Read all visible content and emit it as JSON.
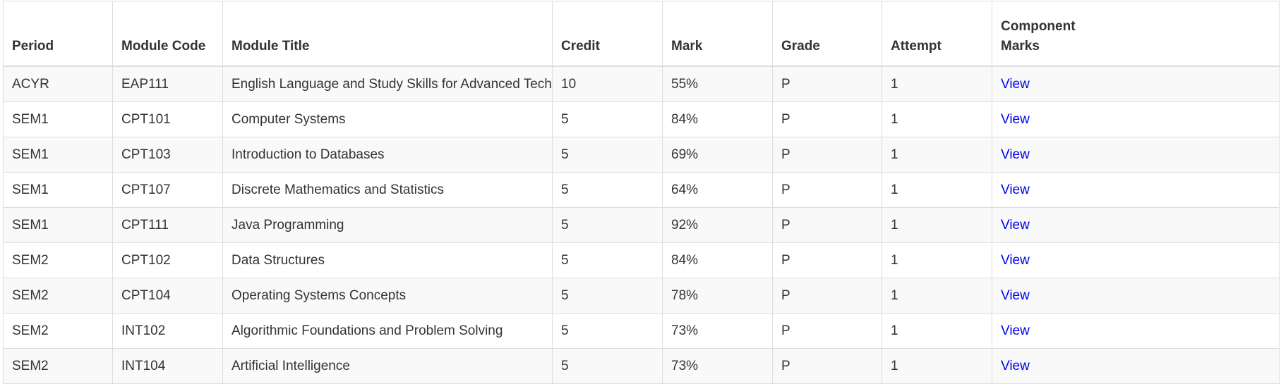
{
  "table": {
    "headers": {
      "period": "Period",
      "module_code": "Module Code",
      "module_title": "Module Title",
      "credit": "Credit",
      "mark": "Mark",
      "grade": "Grade",
      "attempt": "Attempt",
      "component_marks": "Component Marks"
    },
    "rows": [
      {
        "period": "ACYR",
        "module_code": "EAP111",
        "module_title": "English Language and Study Skills for Advanced Technology",
        "credit": "10",
        "mark": "55%",
        "grade": "P",
        "attempt": "1",
        "component_marks": "View"
      },
      {
        "period": "SEM1",
        "module_code": "CPT101",
        "module_title": "Computer Systems",
        "credit": "5",
        "mark": "84%",
        "grade": "P",
        "attempt": "1",
        "component_marks": "View"
      },
      {
        "period": "SEM1",
        "module_code": "CPT103",
        "module_title": "Introduction to Databases",
        "credit": "5",
        "mark": "69%",
        "grade": "P",
        "attempt": "1",
        "component_marks": "View"
      },
      {
        "period": "SEM1",
        "module_code": "CPT107",
        "module_title": "Discrete Mathematics and Statistics",
        "credit": "5",
        "mark": "64%",
        "grade": "P",
        "attempt": "1",
        "component_marks": "View"
      },
      {
        "period": "SEM1",
        "module_code": "CPT111",
        "module_title": "Java Programming",
        "credit": "5",
        "mark": "92%",
        "grade": "P",
        "attempt": "1",
        "component_marks": "View"
      },
      {
        "period": "SEM2",
        "module_code": "CPT102",
        "module_title": "Data Structures",
        "credit": "5",
        "mark": "84%",
        "grade": "P",
        "attempt": "1",
        "component_marks": "View"
      },
      {
        "period": "SEM2",
        "module_code": "CPT104",
        "module_title": "Operating Systems Concepts",
        "credit": "5",
        "mark": "78%",
        "grade": "P",
        "attempt": "1",
        "component_marks": "View"
      },
      {
        "period": "SEM2",
        "module_code": "INT102",
        "module_title": "Algorithmic Foundations and Problem Solving",
        "credit": "5",
        "mark": "73%",
        "grade": "P",
        "attempt": "1",
        "component_marks": "View"
      },
      {
        "period": "SEM2",
        "module_code": "INT104",
        "module_title": "Artificial Intelligence",
        "credit": "5",
        "mark": "73%",
        "grade": "P",
        "attempt": "1",
        "component_marks": "View"
      }
    ]
  },
  "colors": {
    "link": "#0000ee",
    "text": "#333333",
    "stripe": "#f9f9f9",
    "border": "#dddddd"
  }
}
